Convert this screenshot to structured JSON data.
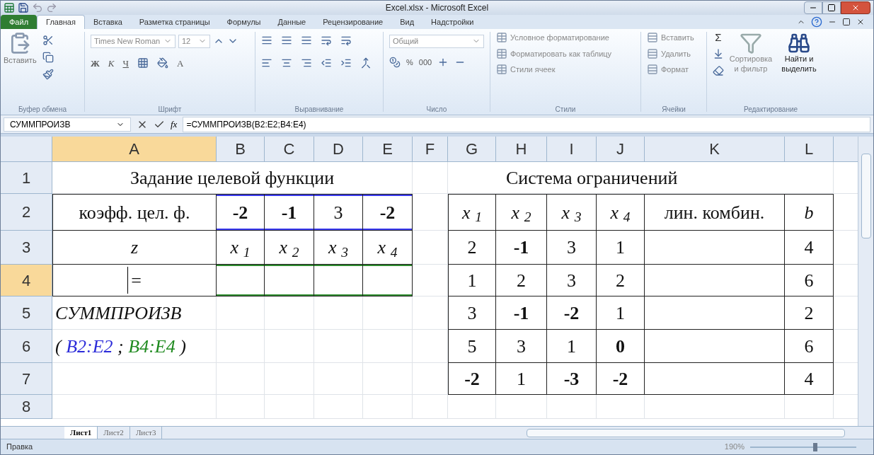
{
  "window": {
    "title": "Excel.xlsx - Microsoft Excel"
  },
  "ribbon_tabs": [
    {
      "label": "Файл",
      "kind": "file",
      "selected": false
    },
    {
      "label": "Главная",
      "kind": "tab",
      "selected": true
    },
    {
      "label": "Вставка",
      "kind": "tab",
      "selected": false
    },
    {
      "label": "Разметка страницы",
      "kind": "tab",
      "selected": false
    },
    {
      "label": "Формулы",
      "kind": "tab",
      "selected": false
    },
    {
      "label": "Данные",
      "kind": "tab",
      "selected": false
    },
    {
      "label": "Рецензирование",
      "kind": "tab",
      "selected": false
    },
    {
      "label": "Вид",
      "kind": "tab",
      "selected": false
    },
    {
      "label": "Надстройки",
      "kind": "tab",
      "selected": false
    }
  ],
  "ribbon": {
    "clipboard": {
      "paste": "Вставить",
      "label": "Буфер обмена"
    },
    "font": {
      "name": "Times New Roman",
      "size": "12",
      "bold": "Ж",
      "italic": "К",
      "underline": "Ч",
      "color_letter": "А",
      "label": "Шрифт"
    },
    "alignment": {
      "label": "Выравнивание"
    },
    "number": {
      "format": "Общий",
      "percent": "%",
      "thousands": "000",
      "label": "Число"
    },
    "styles": {
      "items": [
        "Условное форматирование",
        "Форматировать как таблицу",
        "Стили ячеек"
      ],
      "label": "Стили"
    },
    "cells": {
      "items": [
        "Вставить",
        "Удалить",
        "Формат"
      ],
      "label": "Ячейки"
    },
    "editing": {
      "sum": "Σ",
      "sort": "Сортировка и фильтр",
      "find": "Найти и выделить",
      "label": "Редактирование"
    }
  },
  "formula_bar": {
    "name_box": "СУММПРОИЗВ",
    "fx": "fx",
    "formula": "=СУММПРОИЗВ(B2:E2;B4:E4)"
  },
  "grid": {
    "columns": [
      {
        "label": "A",
        "selected": true
      },
      {
        "label": "B",
        "selected": false
      },
      {
        "label": "C",
        "selected": false
      },
      {
        "label": "D",
        "selected": false
      },
      {
        "label": "E",
        "selected": false
      },
      {
        "label": "F",
        "selected": false
      },
      {
        "label": "G",
        "selected": false
      },
      {
        "label": "H",
        "selected": false
      },
      {
        "label": "I",
        "selected": false
      },
      {
        "label": "J",
        "selected": false
      },
      {
        "label": "K",
        "selected": false
      },
      {
        "label": "L",
        "selected": false
      }
    ],
    "rows": [
      {
        "number": "1",
        "selected": false,
        "kind": "title",
        "cells": [
          {
            "text": "Задание целевой функции"
          },
          {},
          {},
          {},
          {},
          {},
          {},
          {
            "text": "Система ограничений"
          }
        ]
      },
      {
        "number": "2",
        "selected": false,
        "kind": "cells",
        "cells": [
          {
            "text": "коэфф. цел. ф."
          },
          {
            "text": "-2",
            "bold": true,
            "color": "#3b3bf0"
          },
          {
            "text": "-1",
            "bold": true,
            "color": "#3b3bf0"
          },
          {
            "text": "3",
            "color": "#3b3bf0"
          },
          {
            "text": "-2",
            "bold": true,
            "color": "#3b3bf0"
          },
          {},
          {
            "text": "x $_{1}$",
            "italic": true
          },
          {
            "text": "x $_{2}$",
            "italic": true
          },
          {
            "text": "x $_{3}$",
            "italic": true
          },
          {
            "text": "x $_{4}$",
            "italic": true
          },
          {
            "text": "лин. комбин."
          },
          {
            "text": "b",
            "italic": true
          }
        ]
      },
      {
        "number": "3",
        "selected": false,
        "kind": "cells",
        "cells": [
          {
            "text": "z",
            "italic": true
          },
          {
            "text": "x $_{1}$",
            "italic": true
          },
          {
            "text": "x $_{2}$",
            "italic": true
          },
          {
            "text": "x $_{3}$",
            "italic": true
          },
          {
            "text": "x $_{4}$",
            "italic": true
          },
          {},
          {
            "text": "2"
          },
          {
            "text": "-1",
            "bold": true
          },
          {
            "text": "3"
          },
          {
            "text": "1"
          },
          {},
          {
            "text": "4"
          }
        ]
      },
      {
        "number": "4",
        "selected": true,
        "kind": "cells",
        "cells": [
          {
            "text": "=",
            "editing": true
          },
          {
            "color": "#2e8b2e"
          },
          {
            "color": "#2e8b2e"
          },
          {
            "color": "#2e8b2e"
          },
          {
            "color": "#2e8b2e"
          },
          {},
          {
            "text": "1"
          },
          {
            "text": "2"
          },
          {
            "text": "3"
          },
          {
            "text": "2"
          },
          {},
          {
            "text": "6"
          }
        ]
      },
      {
        "number": "5",
        "selected": false,
        "kind": "cells",
        "cells": [
          {
            "text": "СУММПРОИЗВ",
            "italic": true,
            "kind": "overflow"
          },
          {},
          {},
          {},
          {},
          {},
          {
            "text": "3"
          },
          {
            "text": "-1",
            "bold": true
          },
          {
            "text": "-2",
            "bold": true
          },
          {
            "text": "1"
          },
          {},
          {
            "text": "2"
          }
        ]
      },
      {
        "number": "6",
        "selected": false,
        "kind": "cells",
        "cells": [
          {
            "parts": [
              {
                "text": "( ",
                "color": "#111111"
              },
              {
                "text": "B2:E2",
                "color": "#2b2bd9"
              },
              {
                "text": " ; ",
                "color": "#111111"
              },
              {
                "text": "B4:E4",
                "color": "#1f8a1f"
              },
              {
                "text": " )",
                "color": "#111111"
              }
            ],
            "italic": true,
            "kind": "overflow"
          },
          {},
          {},
          {},
          {},
          {},
          {
            "text": "5"
          },
          {
            "text": "3"
          },
          {
            "text": "1"
          },
          {
            "text": "0",
            "bold": true
          },
          {},
          {
            "text": "6"
          }
        ]
      },
      {
        "number": "7",
        "selected": false,
        "kind": "cells",
        "cells": [
          {},
          {},
          {},
          {},
          {},
          {},
          {
            "text": "-2",
            "bold": true
          },
          {
            "text": "1"
          },
          {
            "text": "-3",
            "bold": true
          },
          {
            "text": "-2",
            "bold": true
          },
          {},
          {
            "text": "4"
          }
        ]
      },
      {
        "number": "8",
        "selected": false,
        "kind": "cells",
        "cells": []
      }
    ]
  },
  "sheet_tabs": [
    {
      "label": "Лист1",
      "selected": true
    },
    {
      "label": "Лист2",
      "selected": false
    },
    {
      "label": "Лист3",
      "selected": false
    }
  ],
  "status_bar": {
    "mode": "Правка",
    "zoom": "190%",
    "zoom_slider": {
      "level": 0.62
    }
  }
}
